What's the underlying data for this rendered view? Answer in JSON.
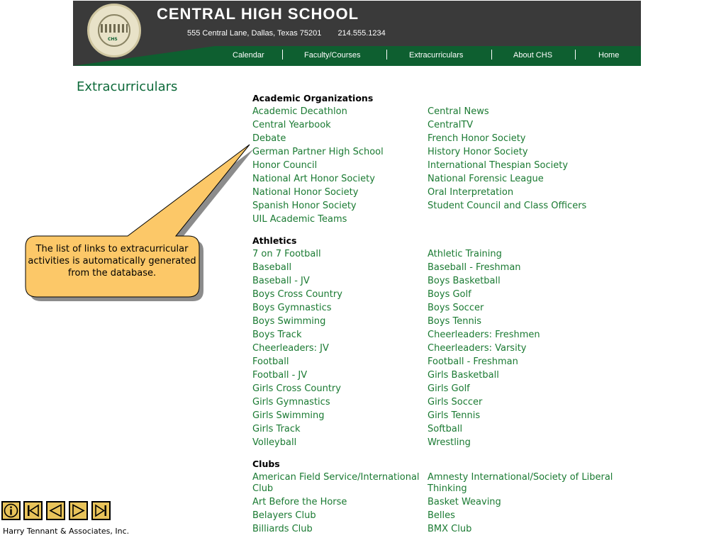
{
  "header": {
    "title": "CENTRAL  HIGH  SCHOOL",
    "address": "555 Central Lane, Dallas, Texas 75201",
    "phone": "214.555.1234",
    "seal_text": "CHS"
  },
  "nav": {
    "calendar": "Calendar",
    "faculty": "Faculty/Courses",
    "extracurriculars": "Extracurriculars",
    "about": "About CHS",
    "home": "Home",
    "separator": "|"
  },
  "page_title": "Extracurriculars",
  "sections": [
    {
      "title": "Academic Organizations",
      "items": [
        "Academic Decathlon",
        "Central News",
        "Central Yearbook",
        "CentralTV",
        "Debate",
        "French Honor Society",
        "German Partner High School",
        "History Honor Society",
        "Honor Council",
        "International Thespian Society",
        "National Art Honor Society",
        "National Forensic League",
        "National Honor Society",
        "Oral Interpretation",
        "Spanish Honor Society",
        "Student Council and Class Officers",
        "UIL Academic Teams"
      ]
    },
    {
      "title": "Athletics",
      "items": [
        "7 on 7 Football",
        "Athletic Training",
        "Baseball",
        "Baseball - Freshman",
        "Baseball - JV",
        "Boys Basketball",
        "Boys Cross Country",
        "Boys Golf",
        "Boys Gymnastics",
        "Boys Soccer",
        "Boys Swimming",
        "Boys Tennis",
        "Boys Track",
        "Cheerleaders: Freshmen",
        "Cheerleaders: JV",
        "Cheerleaders: Varsity",
        "Football",
        "Football - Freshman",
        "Football - JV",
        "Girls Basketball",
        "Girls Cross Country",
        "Girls Golf",
        "Girls Gymnastics",
        "Girls Soccer",
        "Girls Swimming",
        "Girls Tennis",
        "Girls Track",
        "Softball",
        "Volleyball",
        "Wrestling"
      ]
    },
    {
      "title": "Clubs",
      "items": [
        "American Field Service/International Club",
        "Amnesty International/Society of Liberal Thinking",
        "Art Before the Horse",
        "Basket Weaving",
        "Belayers Club",
        "Belles",
        "Billiards Club",
        "BMX Club"
      ]
    }
  ],
  "callout": {
    "text": "The list of links to extracurricular activities is automatically generated from the database."
  },
  "footer": {
    "company": "Harry Tennant & Associates, Inc.",
    "buttons": [
      "info-icon",
      "first-slide-icon",
      "previous-slide-icon",
      "next-slide-icon",
      "last-slide-icon"
    ]
  },
  "colors": {
    "header_bg": "#3a3a3a",
    "nav_green": "#0e5f30",
    "link_green": "#1a7a32",
    "title_green": "#0e6a3a",
    "callout_fill": "#fcc868",
    "button_fill": "#e8c35a"
  }
}
